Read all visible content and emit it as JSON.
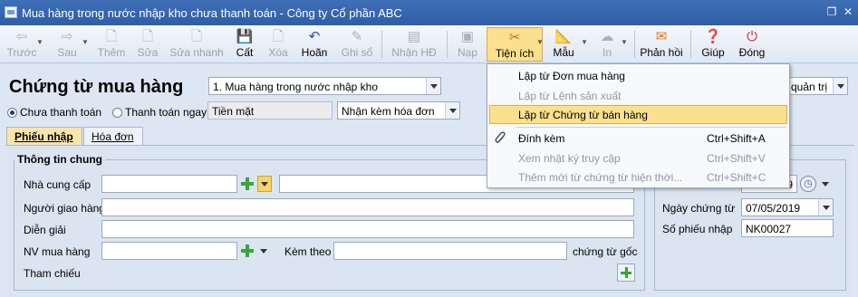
{
  "window": {
    "title": "Mua hàng trong nước nhập kho chưa thanh toán - Công ty Cổ phần ABC"
  },
  "toolbar": {
    "prev": "Trước",
    "next": "Sau",
    "add": "Thêm",
    "edit": "Sửa",
    "quick_edit": "Sửa nhanh",
    "save": "Cất",
    "delete": "Xóa",
    "undo": "Hoãn",
    "post": "Ghi sổ",
    "receive_invoice": "Nhận HĐ",
    "load": "Nạp",
    "utilities": "Tiện ích",
    "template": "Mẫu",
    "print": "In",
    "feedback": "Phản hồi",
    "help": "Giúp",
    "close": "Đóng"
  },
  "header": {
    "title": "Chứng từ mua hàng",
    "voucher_type": "1. Mua hàng trong nước nhập kho",
    "payment_unpaid": "Chưa thanh toán",
    "payment_paid": "Thanh toán ngay",
    "payment_method": "Tiền mặt",
    "invoice_option": "Nhận kèm hóa đơn",
    "admin_combo": "quản trị"
  },
  "tabs": {
    "receipt": "Phiếu nhập",
    "invoice": "Hóa đơn"
  },
  "general": {
    "group_title": "Thông tin chung",
    "supplier_label": "Nhà cung cấp",
    "deliverer_label": "Người giao hàng",
    "description_label": "Diễn giải",
    "buyer_label": "NV mua hàng",
    "attach_label": "Kèm theo",
    "attach_suffix": "chứng từ gốc",
    "reference_label": "Tham chiếu"
  },
  "voucher": {
    "date_label": "Ngày chứng từ",
    "date_value": "07/05/2019",
    "number_label": "Số phiếu nhập",
    "number_value": "NK00027",
    "posting_date_fragment": "9"
  },
  "menu": {
    "items": [
      {
        "label": "Lập từ Đơn mua hàng",
        "shortcut": ""
      },
      {
        "label": "Lập từ Lệnh sản xuất",
        "shortcut": ""
      },
      {
        "label": "Lập từ Chứng từ bán hàng",
        "shortcut": ""
      },
      {
        "label": "Đính kèm",
        "shortcut": "Ctrl+Shift+A"
      },
      {
        "label": "Xem nhật ký truy cập",
        "shortcut": "Ctrl+Shift+V"
      },
      {
        "label": "Thêm mới từ chứng từ hiện thời...",
        "shortcut": "Ctrl+Shift+C"
      }
    ]
  },
  "colors": {
    "titlebar": "#3366b3",
    "highlight": "#fbe08f",
    "accent_green": "#3aa63a"
  }
}
